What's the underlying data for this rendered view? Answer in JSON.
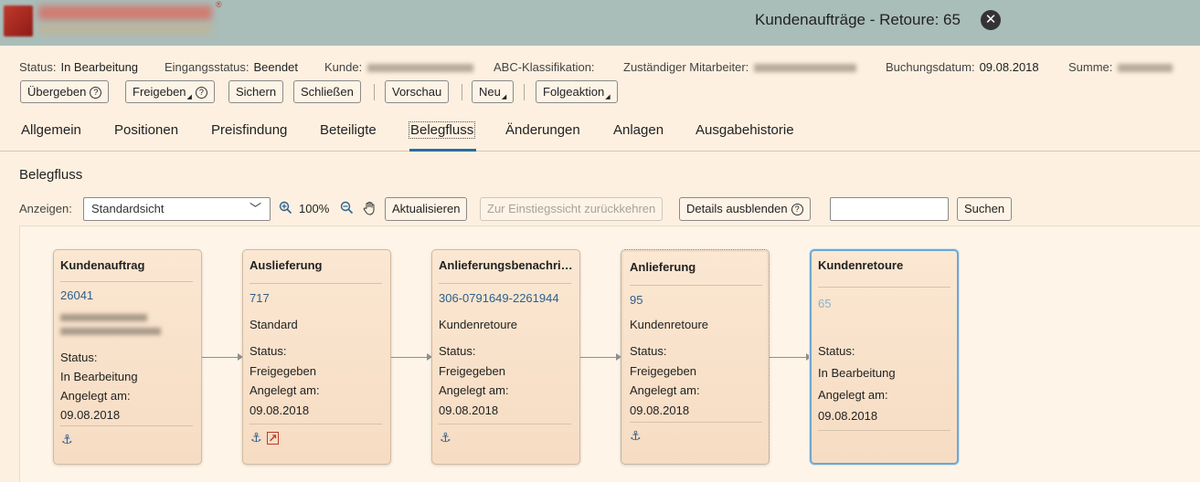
{
  "shell": {
    "title": "Kundenaufträge - Retoure: 65",
    "close_symbol": "✕"
  },
  "header": {
    "status_label": "Status:",
    "status_value": "In Bearbeitung",
    "entry_label": "Eingangsstatus:",
    "entry_value": "Beendet",
    "customer_label": "Kunde:",
    "abc_label": "ABC-Klassifikation:",
    "employee_label": "Zuständiger Mitarbeiter:",
    "date_label": "Buchungsdatum:",
    "date_value": "09.08.2018",
    "sum_label": "Summe:"
  },
  "actions": {
    "handover": "Übergeben",
    "release": "Freigeben",
    "save": "Sichern",
    "close": "Schließen",
    "preview": "Vorschau",
    "new": "Neu",
    "followup": "Folgeaktion"
  },
  "tabs": [
    "Allgemein",
    "Positionen",
    "Preisfindung",
    "Beteiligte",
    "Belegfluss",
    "Änderungen",
    "Anlagen",
    "Ausgabehistorie"
  ],
  "section": {
    "title": "Belegfluss"
  },
  "toolbar": {
    "show_label": "Anzeigen:",
    "view_value": "Standardsicht",
    "zoom": "100%",
    "refresh": "Aktualisieren",
    "back_entry": "Zur Einstiegssicht zurückkehren",
    "hide_details": "Details ausblenden",
    "search": "Suchen"
  },
  "nodes": [
    {
      "title": "Kundenauftrag",
      "number": "26041",
      "status_label": "Status:",
      "status": "In Bearbeitung",
      "created_label": "Angelegt am:",
      "created": "09.08.2018"
    },
    {
      "title": "Auslieferung",
      "number": "717",
      "type": "Standard",
      "status_label": "Status:",
      "status": "Freigegeben",
      "created_label": "Angelegt am:",
      "created": "09.08.2018"
    },
    {
      "title": "Anlieferungsbenachrichtigung",
      "number": "306-0791649-2261944",
      "type": "Kundenretoure",
      "status_label": "Status:",
      "status": "Freigegeben",
      "created_label": "Angelegt am:",
      "created": "09.08.2018"
    },
    {
      "title": "Anlieferung",
      "number": "95",
      "type": "Kundenretoure",
      "status_label": "Status:",
      "status": "Freigegeben",
      "created_label": "Angelegt am:",
      "created": "09.08.2018"
    },
    {
      "title": "Kundenretoure",
      "number": "65",
      "status_label": "Status:",
      "status": "In Bearbeitung",
      "created_label": "Angelegt am:",
      "created": "09.08.2018"
    }
  ],
  "colors": {
    "shell": "#a9bdb9",
    "background": "#fdf0e0",
    "link": "#2c5f8e",
    "selected_border": "#6fa7d1"
  }
}
